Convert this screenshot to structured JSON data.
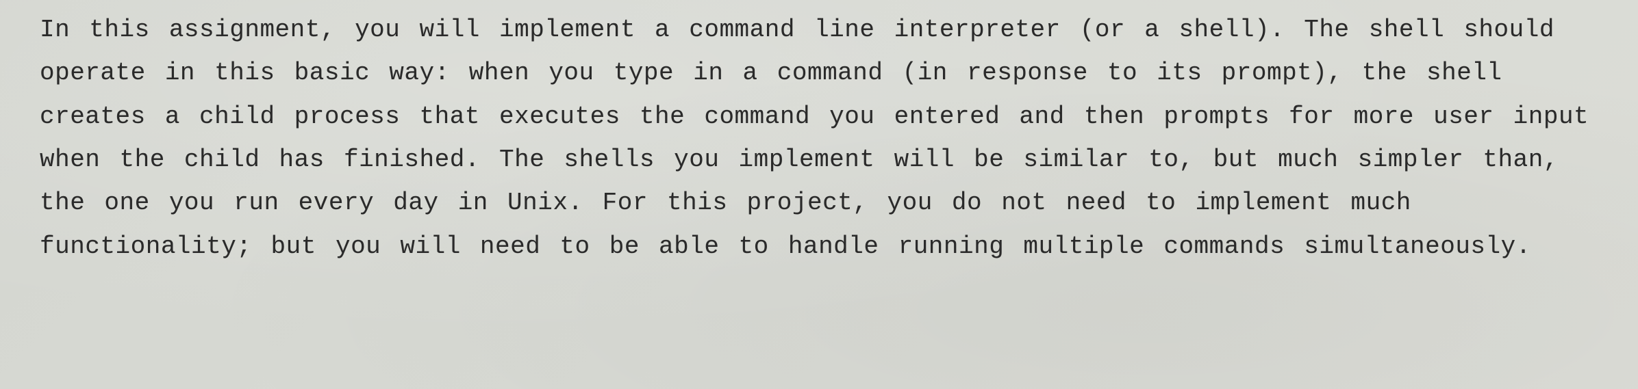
{
  "document": {
    "paragraph": "In this assignment, you will implement a command line interpreter (or a shell). The shell should operate in this basic way: when you type in a command (in response to its prompt), the shell creates a child process that executes the command you entered and then prompts for more user input when the child has finished. The shells you implement will be similar to, but much simpler than, the one you run every day in Unix. For this project, you do not need to implement much functionality; but you will need to be able to handle running multiple commands simultaneously."
  }
}
